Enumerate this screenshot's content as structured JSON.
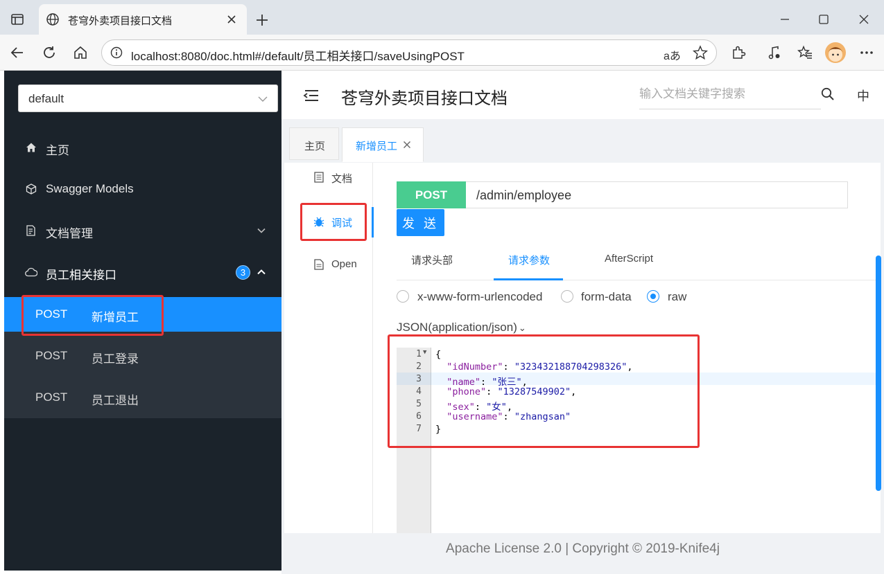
{
  "browser": {
    "tab_title": "苍穹外卖项目接口文档",
    "url": "localhost:8080/doc.html#/default/员工相关接口/saveUsingPOST",
    "translate_icon": "aあ"
  },
  "sidebar": {
    "group_select": "default",
    "items": [
      {
        "label": "主页",
        "icon": "home-icon"
      },
      {
        "label": "Swagger Models",
        "icon": "models-icon"
      },
      {
        "label": "文档管理",
        "icon": "doc-manage-icon"
      },
      {
        "label": "员工相关接口",
        "icon": "cloud-icon",
        "badge": "3"
      }
    ],
    "submenu": [
      {
        "method": "POST",
        "label": "新增员工"
      },
      {
        "method": "POST",
        "label": "员工登录"
      },
      {
        "method": "POST",
        "label": "员工退出"
      }
    ]
  },
  "header": {
    "title": "苍穹外卖项目接口文档",
    "search_placeholder": "输入文档关键字搜索",
    "lang": "中"
  },
  "tabs": [
    {
      "label": "主页"
    },
    {
      "label": "新增员工"
    }
  ],
  "leftnav": [
    {
      "label": "文档"
    },
    {
      "label": "调试"
    },
    {
      "label": "Open"
    }
  ],
  "request": {
    "method": "POST",
    "path": "/admin/employee",
    "send_label": "发 送"
  },
  "request_tabs": [
    "请求头部",
    "请求参数",
    "AfterScript"
  ],
  "body_types": [
    "x-www-form-urlencoded",
    "form-data",
    "raw"
  ],
  "content_type": "JSON(application/json)",
  "code": {
    "line_numbers": [
      "1",
      "2",
      "3",
      "4",
      "5",
      "6",
      "7"
    ],
    "open_brace": "{",
    "close_brace": "}",
    "fields": [
      {
        "key": "\"idNumber\"",
        "value": "\"323432188704298326\""
      },
      {
        "key": "\"name\"",
        "value": "\"张三\""
      },
      {
        "key": "\"phone\"",
        "value": "\"13287549902\""
      },
      {
        "key": "\"sex\"",
        "value": "\"女\""
      },
      {
        "key": "\"username\"",
        "value": "\"zhangsan\""
      }
    ]
  },
  "footer": "Apache License 2.0 | Copyright © 2019-Knife4j",
  "colors": {
    "accent": "#1890ff",
    "post": "#49cc90",
    "sidebar": "#1b232b",
    "highlight": "#e83333"
  }
}
